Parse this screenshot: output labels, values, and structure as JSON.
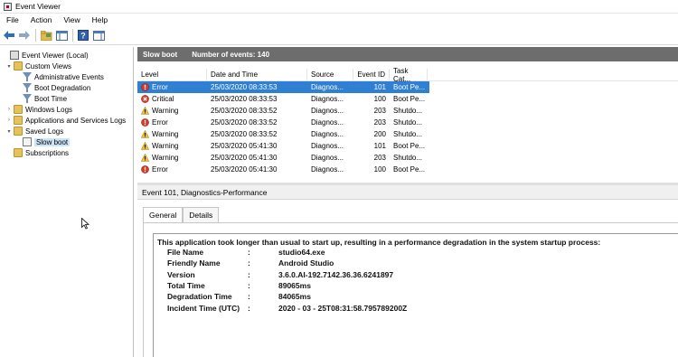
{
  "window": {
    "title": "Event Viewer"
  },
  "menu": [
    "File",
    "Action",
    "View",
    "Help"
  ],
  "toolbar": {
    "icons": [
      "back-arrow-icon",
      "forward-arrow-icon",
      "open-folder-icon",
      "console-tree-icon",
      "help-icon",
      "action-pane-icon"
    ]
  },
  "tree": {
    "items": [
      {
        "label": "Event Viewer (Local)",
        "level": 0,
        "icon": "event-viewer-icon",
        "expander": ""
      },
      {
        "label": "Custom Views",
        "level": 1,
        "icon": "folder-icon",
        "expander": "▾"
      },
      {
        "label": "Administrative Events",
        "level": 2,
        "icon": "filter-icon",
        "expander": ""
      },
      {
        "label": "Boot Degradation",
        "level": 2,
        "icon": "filter-icon",
        "expander": ""
      },
      {
        "label": "Boot Time",
        "level": 2,
        "icon": "filter-icon",
        "expander": ""
      },
      {
        "label": "Windows Logs",
        "level": 1,
        "icon": "folder-icon",
        "expander": "›"
      },
      {
        "label": "Applications and Services Logs",
        "level": 1,
        "icon": "folder-icon",
        "expander": "›"
      },
      {
        "label": "Saved Logs",
        "level": 1,
        "icon": "folder-icon",
        "expander": "▾"
      },
      {
        "label": "Slow boot",
        "level": 2,
        "icon": "log-icon",
        "expander": "",
        "selected": true
      },
      {
        "label": "Subscriptions",
        "level": 1,
        "icon": "subscriptions-icon",
        "expander": ""
      }
    ]
  },
  "pane_header": {
    "title": "Slow boot",
    "count_label": "Number of events: 140"
  },
  "grid": {
    "columns": [
      "Level",
      "Date and Time",
      "Source",
      "Event ID",
      "Task Cat..."
    ],
    "rows": [
      {
        "level": "Error",
        "icon": "error-icon",
        "date": "25/03/2020 08:33:53",
        "source": "Diagnos...",
        "id": "101",
        "task": "Boot Pe..."
      },
      {
        "level": "Critical",
        "icon": "critical-icon",
        "date": "25/03/2020 08:33:53",
        "source": "Diagnos...",
        "id": "100",
        "task": "Boot Pe..."
      },
      {
        "level": "Warning",
        "icon": "warning-icon",
        "date": "25/03/2020 08:33:52",
        "source": "Diagnos...",
        "id": "203",
        "task": "Shutdo..."
      },
      {
        "level": "Error",
        "icon": "error-icon",
        "date": "25/03/2020 08:33:52",
        "source": "Diagnos...",
        "id": "203",
        "task": "Shutdo..."
      },
      {
        "level": "Warning",
        "icon": "warning-icon",
        "date": "25/03/2020 08:33:52",
        "source": "Diagnos...",
        "id": "200",
        "task": "Shutdo..."
      },
      {
        "level": "Warning",
        "icon": "warning-icon",
        "date": "25/03/2020 05:41:30",
        "source": "Diagnos...",
        "id": "101",
        "task": "Boot Pe..."
      },
      {
        "level": "Warning",
        "icon": "warning-icon",
        "date": "25/03/2020 05:41:30",
        "source": "Diagnos...",
        "id": "203",
        "task": "Shutdo..."
      },
      {
        "level": "Error",
        "icon": "error-icon",
        "date": "25/03/2020 05:41:30",
        "source": "Diagnos...",
        "id": "100",
        "task": "Boot Pe..."
      }
    ]
  },
  "detail": {
    "header": "Event 101, Diagnostics-Performance",
    "tabs": [
      "General",
      "Details"
    ],
    "message": "This application took longer than usual to start up, resulting in a performance degradation in the system startup process:",
    "fields": [
      {
        "key": "File Name",
        "value": "studio64.exe"
      },
      {
        "key": "Friendly Name",
        "value": "Android Studio"
      },
      {
        "key": "Version",
        "value": "3.6.0.AI-192.7142.36.36.6241897"
      },
      {
        "key": "Total Time",
        "value": "89065ms"
      },
      {
        "key": "Degradation Time",
        "value": "84065ms"
      },
      {
        "key": "Incident Time (UTC)",
        "value": "2020 - 03 - 25T08:31:58.795789200Z"
      }
    ],
    "separator": ":"
  }
}
